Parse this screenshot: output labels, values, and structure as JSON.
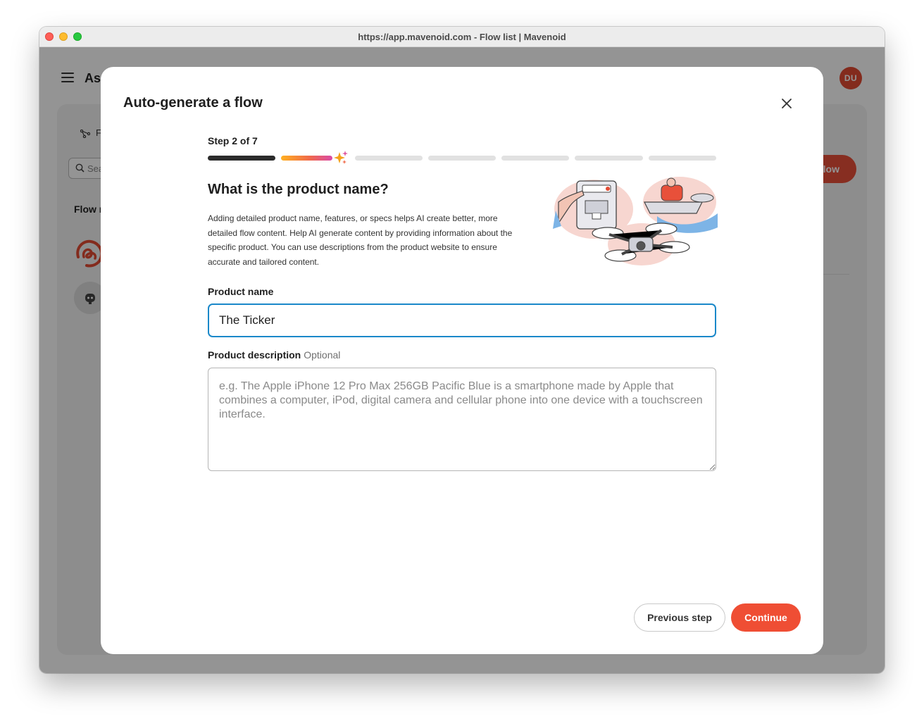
{
  "window": {
    "title": "https://app.mavenoid.com - Flow list | Mavenoid"
  },
  "background_app": {
    "title": "Ass",
    "avatar_initials": "DU",
    "tab_label": "F",
    "search_placeholder": "Sea",
    "new_flow_label": "flow",
    "section_title": "Flow n",
    "icons": [
      "menu-icon",
      "flows-icon",
      "search-icon",
      "mavenoid-logo-icon",
      "bot-avatar-icon"
    ]
  },
  "modal": {
    "title": "Auto-generate a flow",
    "close_icon": "close-icon",
    "step_label": "Step 2 of 7",
    "progress": {
      "current_step": 2,
      "total_steps": 7,
      "completed": 1
    },
    "question": "What is the product name?",
    "help_text": "Adding detailed product name, features, or specs helps AI create better, more detailed flow content. Help AI generate content by providing information about the specific product. You can use descriptions from the product website to ensure accurate and tailored content.",
    "illustration": "product-illustration (coffee machine, boat, drone)",
    "product_name": {
      "label": "Product name",
      "value": "The Ticker"
    },
    "product_description": {
      "label": "Product description",
      "optional_label": "Optional",
      "value": "",
      "placeholder": "e.g. The Apple iPhone 12 Pro Max 256GB Pacific Blue is a smartphone made by Apple that combines a computer, iPod, digital camera and cellular phone into one device with a touchscreen interface."
    },
    "buttons": {
      "previous": "Previous step",
      "continue": "Continue"
    }
  },
  "colors": {
    "accent": "#ef4e34",
    "focus_border": "#1a88c9",
    "progress_done": "#2c2c2c",
    "progress_pending": "#e1e1e1"
  }
}
